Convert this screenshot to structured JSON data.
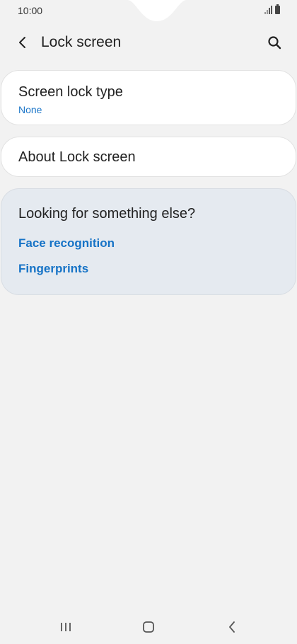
{
  "status_bar": {
    "time": "10:00",
    "icons": [
      "signal-icon",
      "battery-icon"
    ]
  },
  "header": {
    "title": "Lock screen",
    "back_icon": "back-arrow-icon",
    "search_icon": "search-icon"
  },
  "settings": [
    {
      "title": "Screen lock type",
      "subtitle": "None"
    },
    {
      "title": "About Lock screen"
    }
  ],
  "suggestions": {
    "title": "Looking for something else?",
    "links": [
      "Face recognition",
      "Fingerprints"
    ]
  },
  "nav_bar": {
    "icons": [
      "recents-icon",
      "home-icon",
      "back-icon"
    ]
  },
  "colors": {
    "background": "#f2f2f2",
    "card": "#ffffff",
    "suggestion_card": "#e5eaf0",
    "accent_link": "#1673c6"
  }
}
